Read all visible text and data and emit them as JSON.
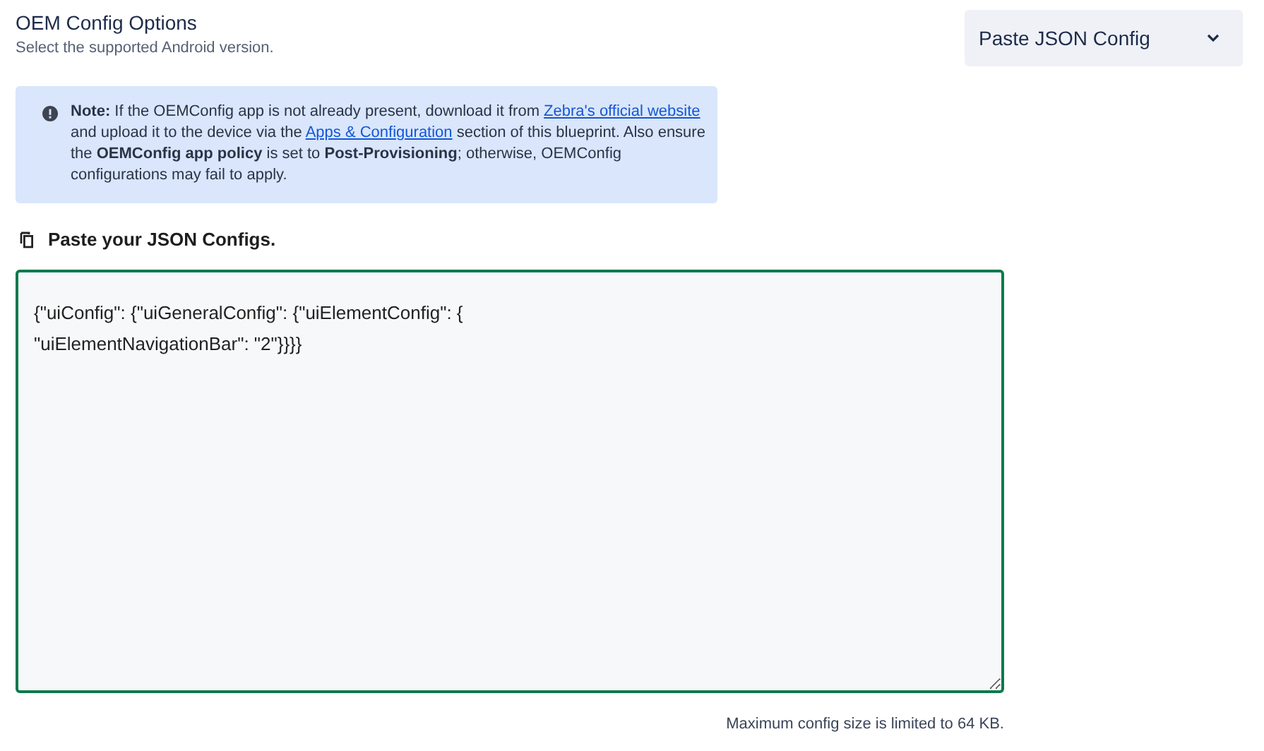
{
  "header": {
    "title": "OEM Config Options",
    "subtitle": "Select the supported Android version."
  },
  "mode_dropdown": {
    "value": "Paste JSON Config",
    "expanded": false
  },
  "note": {
    "parts": [
      {
        "kind": "text",
        "text": "**Note:** If the OEMConfig app is not already present, download it from "
      },
      {
        "kind": "link",
        "text": "Zebra's official website"
      },
      {
        "kind": "text",
        "text": " and upload it to the device via the "
      },
      {
        "kind": "link",
        "text": "Apps & Configuration"
      },
      {
        "kind": "text",
        "text": " section of this blueprint. Also ensure the **OEMConfig app policy** is set to **Post-Provisioning**; otherwise, OEMConfig configurations may fail to apply."
      }
    ]
  },
  "json_section": {
    "heading": "Paste your JSON Configs.",
    "value": "{\"uiConfig\": {\"uiGeneralConfig\": {\"uiElementConfig\": {\n\"uiElementNavigationBar\": \"2\"}}}}",
    "focused": true
  },
  "size_hint": "Maximum config size is limited to 64 KB."
}
